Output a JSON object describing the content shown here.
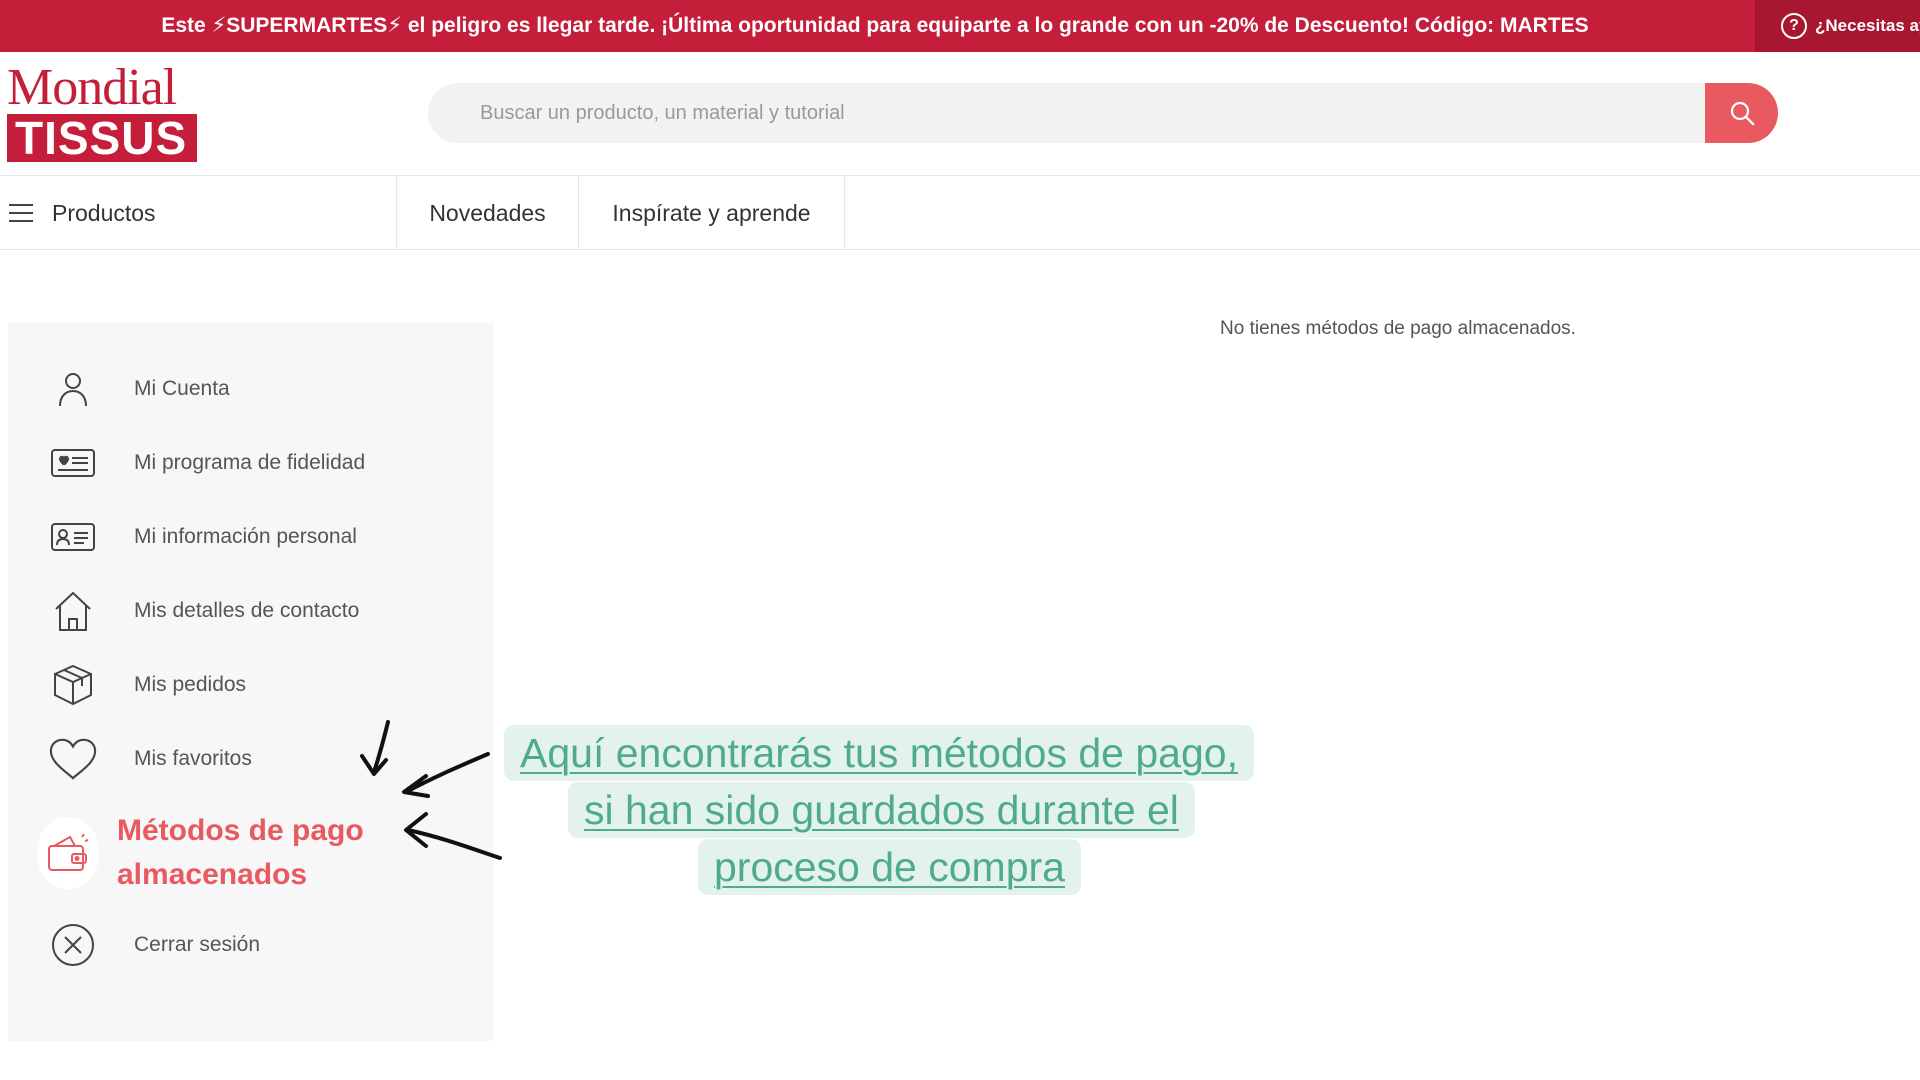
{
  "promo": {
    "text": "Este ⚡SUPERMARTES⚡ el peligro es llegar tarde. ¡Última oportunidad para equiparte a lo grande con un -20% de Descuento! Código: MARTES",
    "help_label": "¿Necesitas ay"
  },
  "logo": {
    "line1": "Mondial",
    "line2": "TISSUS"
  },
  "search": {
    "placeholder": "Buscar un producto, un material y tutorial"
  },
  "nav": {
    "products_label": "Productos",
    "tabs": [
      {
        "label": "Novedades"
      },
      {
        "label": "Inspírate y aprende"
      }
    ]
  },
  "sidebar": {
    "items": [
      {
        "label": "Mi Cuenta",
        "icon": "user-icon"
      },
      {
        "label": "Mi programa de fidelidad",
        "icon": "loyalty-card-icon"
      },
      {
        "label": "Mi información personal",
        "icon": "id-card-icon"
      },
      {
        "label": "Mis detalles de contacto",
        "icon": "home-icon"
      },
      {
        "label": "Mis pedidos",
        "icon": "package-icon"
      },
      {
        "label": "Mis favoritos",
        "icon": "heart-icon"
      },
      {
        "label": "Métodos de pago almacenados",
        "line1": "Métodos de pago",
        "line2": "almacenados",
        "icon": "wallet-icon",
        "active": true
      },
      {
        "label": "Cerrar sesión",
        "icon": "logout-icon"
      }
    ]
  },
  "main": {
    "empty_message": "No tienes métodos de pago almacenados."
  },
  "callout": {
    "line1": "Aquí encontrarás tus métodos de pago,",
    "line2": "si han sido guardados durante el",
    "line3": "proceso de compra "
  },
  "colors": {
    "brand_red": "#c41e3a",
    "accent_coral": "#e85a5f",
    "callout_green": "#4eab8e",
    "callout_bg": "#e4f2ec"
  }
}
